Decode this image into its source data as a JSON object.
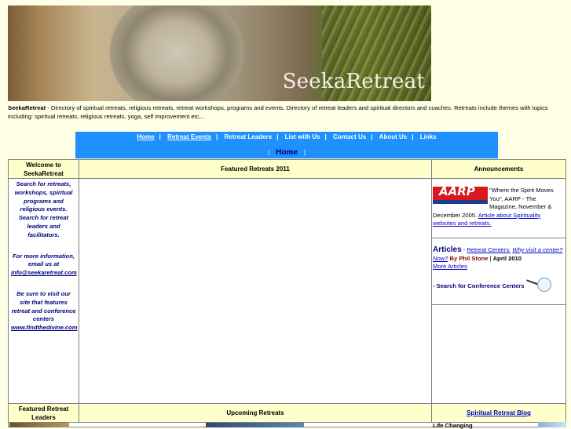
{
  "banner": {
    "title": "SeekaRetreat"
  },
  "intro": {
    "brand": "SeekaRetreat",
    "text": " - Directory of spiritual retreats, religious retreats, retreat workshops, programs and events. Directory of retreat leaders and spiritual directors and coaches. Retreats include themes with topics including: spiritual retreats, religious retreats, yoga, self improvement etc..."
  },
  "nav": {
    "items": [
      "Home",
      "Retreat Events",
      "Retreat Leaders",
      "List with Us",
      "Contact Us",
      "About Us",
      "Links"
    ],
    "separator": "|",
    "current": "Home"
  },
  "left": {
    "header": "Welcome to SeekaRetreat",
    "search_text": "Search for retreats, workshops, spiritual programs and religious events. Search for retreat leaders and facilitators.",
    "info_text": "For more information, email us at",
    "email": "info@seekaretreat.com",
    "visit_text": "Be sure to visit our site that features retreat and conference centers",
    "site_link": "www.findthedivine.com",
    "leaders_header": "Featured Retreat Leaders"
  },
  "center": {
    "featured_header": "Featured Retreats 2011",
    "upcoming_header": "Upcoming Retreats"
  },
  "right": {
    "header": "Announcements",
    "aarp_logo": "AARP",
    "aarp_text": "\"Where the Spirit Moves You\", AARP - The Magazine, November & December 2005.",
    "aarp_link": "Article about Spirituality websites and retreats.",
    "articles_title": "Articles",
    "articles_dash": " - ",
    "articles_link1": "Retreat Centers:",
    "articles_link2": "Why visit a center? Now?",
    "articles_by": "By Phil Stone",
    "articles_date": "April 2010",
    "more_articles": "More Articles",
    "conf_search": "- Search for Conference Centers",
    "blog_header": "Spiritual Retreat Blog",
    "blog_item": "Life Changing"
  }
}
